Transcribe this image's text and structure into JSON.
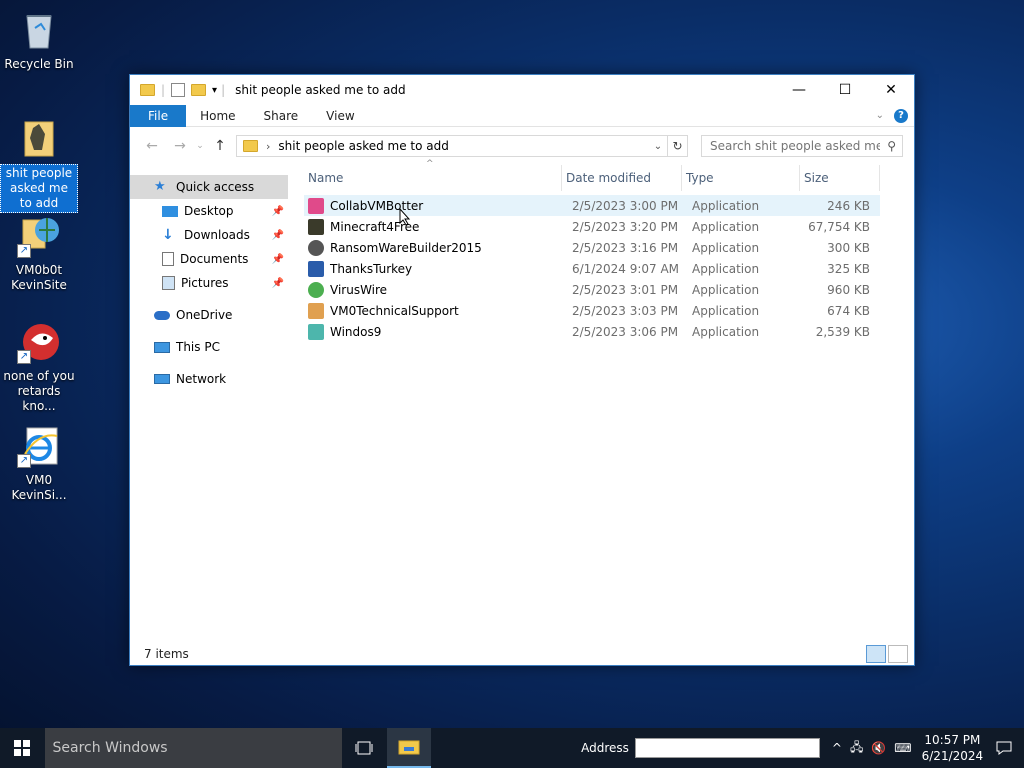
{
  "desktop": {
    "icons": [
      {
        "label": "Recycle Bin"
      },
      {
        "label": "shit people asked me to add"
      },
      {
        "label": "VM0b0t KevinSite"
      },
      {
        "label": "none of you retards kno..."
      },
      {
        "label": "VM0 KevinSi..."
      }
    ]
  },
  "window": {
    "title": "shit people asked me to add",
    "ribbon": {
      "file": "File",
      "home": "Home",
      "share": "Share",
      "view": "View"
    },
    "address": {
      "crumb": "shit people asked me to add"
    },
    "search": {
      "placeholder": "Search shit people asked me t..."
    },
    "nav": {
      "quick_access": "Quick access",
      "desktop": "Desktop",
      "downloads": "Downloads",
      "documents": "Documents",
      "pictures": "Pictures",
      "onedrive": "OneDrive",
      "this_pc": "This PC",
      "network": "Network"
    },
    "columns": {
      "name": "Name",
      "date": "Date modified",
      "type": "Type",
      "size": "Size"
    },
    "files": [
      {
        "name": "CollabVMBotter",
        "date": "2/5/2023 3:00 PM",
        "type": "Application",
        "size": "246 KB"
      },
      {
        "name": "Minecraft4Free",
        "date": "2/5/2023 3:20 PM",
        "type": "Application",
        "size": "67,754 KB"
      },
      {
        "name": "RansomWareBuilder2015",
        "date": "2/5/2023 3:16 PM",
        "type": "Application",
        "size": "300 KB"
      },
      {
        "name": "ThanksTurkey",
        "date": "6/1/2024 9:07 AM",
        "type": "Application",
        "size": "325 KB"
      },
      {
        "name": "VirusWire",
        "date": "2/5/2023 3:01 PM",
        "type": "Application",
        "size": "960 KB"
      },
      {
        "name": "VM0TechnicalSupport",
        "date": "2/5/2023 3:03 PM",
        "type": "Application",
        "size": "674 KB"
      },
      {
        "name": "Windos9",
        "date": "2/5/2023 3:06 PM",
        "type": "Application",
        "size": "2,539 KB"
      }
    ],
    "status": "7 items"
  },
  "taskbar": {
    "search_placeholder": "Search Windows",
    "address_label": "Address",
    "time": "10:57 PM",
    "date": "6/21/2024"
  }
}
